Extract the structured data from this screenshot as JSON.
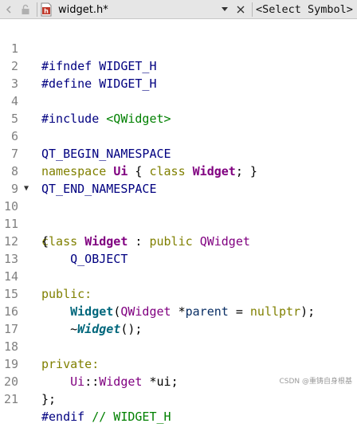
{
  "toolbar": {
    "filename": "widget.h*",
    "symbol_selector": "<Select Symbol>",
    "icons": [
      "navigate-back-icon",
      "lock-icon",
      "header-file-icon",
      "dropdown-arrow-icon",
      "close-icon"
    ]
  },
  "editor": {
    "line_numbers": [
      "1",
      "2",
      "3",
      "4",
      "5",
      "6",
      "7",
      "8",
      "9",
      "10",
      "11",
      "12",
      "13",
      "14",
      "15",
      "16",
      "17",
      "18",
      "19",
      "20",
      "21"
    ],
    "fold_marker": "▼",
    "tokens": {
      "ifndef": "#ifndef",
      "define": "#define",
      "include": "#include",
      "endif": "#endif",
      "widget_h": "WIDGET_H",
      "qwidget_include": "<QWidget>",
      "qt_begin": "QT_BEGIN_NAMESPACE",
      "qt_end": "QT_END_NAMESPACE",
      "namespace": "namespace",
      "ui": "Ui",
      "class": "class",
      "widget": "Widget",
      "public_kw": "public",
      "qwidget": "QWidget",
      "q_object": "Q_OBJECT",
      "public_label": "public:",
      "private_label": "private:",
      "parent": "parent",
      "nullptr": "nullptr",
      "ui_var": "ui",
      "comment_endif": "// WIDGET_H"
    }
  },
  "watermark": "CSDN @重铸自身根基"
}
